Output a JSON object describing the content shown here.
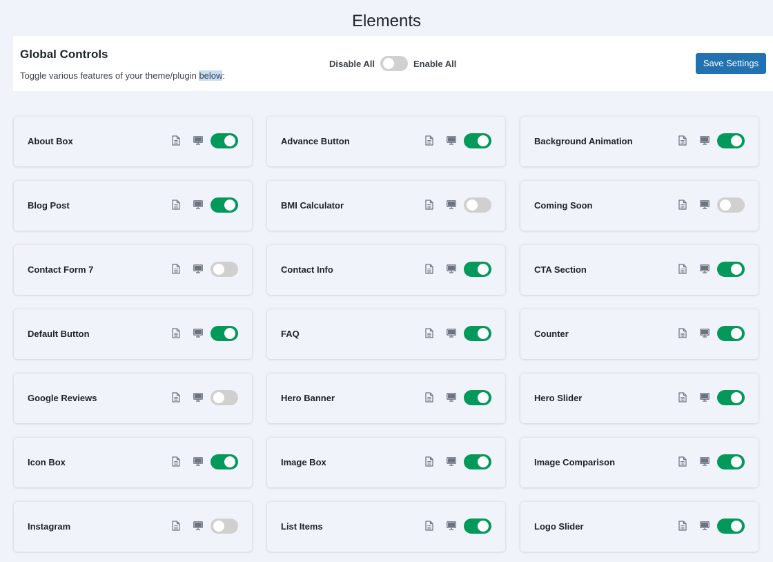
{
  "page": {
    "title": "Elements"
  },
  "global_controls": {
    "title": "Global Controls",
    "description_prefix": "Toggle various features of your theme/plugin ",
    "description_highlight": "below",
    "description_suffix": ":",
    "disable_all_label": "Disable All",
    "enable_all_label": "Enable All",
    "mass_toggle_on": false,
    "save_label": "Save Settings"
  },
  "icons": {
    "doc": "document-icon",
    "demo": "desktop-icon"
  },
  "colors": {
    "toggle_on": "#03995a",
    "toggle_off": "#d0d0d0",
    "save_button": "#2271b1"
  },
  "elements": [
    {
      "label": "About Box",
      "enabled": true
    },
    {
      "label": "Advance Button",
      "enabled": true
    },
    {
      "label": "Background Animation",
      "enabled": true
    },
    {
      "label": "Blog Post",
      "enabled": true
    },
    {
      "label": "BMI Calculator",
      "enabled": false
    },
    {
      "label": "Coming Soon",
      "enabled": false
    },
    {
      "label": "Contact Form 7",
      "enabled": false
    },
    {
      "label": "Contact Info",
      "enabled": true
    },
    {
      "label": "CTA Section",
      "enabled": true
    },
    {
      "label": "Default Button",
      "enabled": true
    },
    {
      "label": "FAQ",
      "enabled": true
    },
    {
      "label": "Counter",
      "enabled": true
    },
    {
      "label": "Google Reviews",
      "enabled": false
    },
    {
      "label": "Hero Banner",
      "enabled": true
    },
    {
      "label": "Hero Slider",
      "enabled": true
    },
    {
      "label": "Icon Box",
      "enabled": true
    },
    {
      "label": "Image Box",
      "enabled": true
    },
    {
      "label": "Image Comparison",
      "enabled": true
    },
    {
      "label": "Instagram",
      "enabled": false
    },
    {
      "label": "List Items",
      "enabled": true
    },
    {
      "label": "Logo Slider",
      "enabled": true
    }
  ]
}
